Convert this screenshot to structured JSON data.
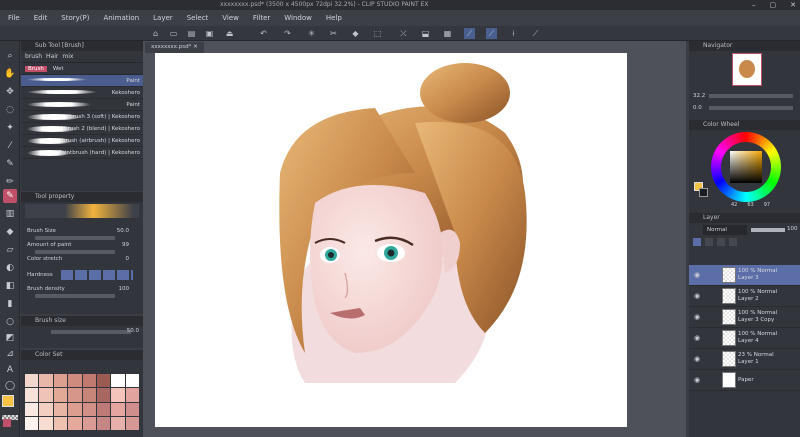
{
  "window": {
    "title": "xxxxxxxx.psd* (3500 x 4500px 72dpi 32.2%) - CLIP STUDIO PAINT EX",
    "doc_tab": "xxxxxxxx.psd*",
    "controls": [
      "–",
      "▢",
      "✕"
    ]
  },
  "menu": [
    "File",
    "Edit",
    "Story(P)",
    "Animation",
    "Layer",
    "Select",
    "View",
    "Filter",
    "Window",
    "Help"
  ],
  "subtool": {
    "title": "Sub Tool [Brush]",
    "tabs": [
      "brush",
      "Hair",
      "mix"
    ],
    "groups": [
      "Brush",
      "Wet"
    ],
    "brushes": [
      "Paint",
      "Paintbrush (soft)",
      "Paintbrush (blend)",
      "Paintbrush (airbrush)",
      "Paintbrush (hard)",
      "Kekoshero",
      "Kekoshero"
    ],
    "labels": [
      "Paint",
      "Paintbrush 3 (soft) | Kekoshero",
      "Paintbrush 2 (blend) | Kekoshero",
      "Paintbrush (airbrush) | Kekoshero",
      "Paintbrush (hard) | Kekoshero"
    ]
  },
  "toolprop": {
    "title": "Tool property",
    "brush_size_label": "Brush Size",
    "brush_size_value": "50.0",
    "amount_label": "Amount of paint",
    "amount_value": "99",
    "stretch_label": "Color stretch",
    "stretch_value": "0",
    "hardness_label": "Hardness",
    "density_label": "Brush density",
    "density_value": "100"
  },
  "brushsize": {
    "title": "Brush size",
    "value": "50.0"
  },
  "colorset": {
    "title": "Color Set"
  },
  "navigator": {
    "title": "Navigator",
    "zoom": "32.2",
    "rotate": "0.0"
  },
  "colorwheel": {
    "title": "Color Wheel",
    "values": [
      "42",
      "63",
      "97"
    ]
  },
  "layer": {
    "title": "Layer",
    "blend": "Normal",
    "opacity": "100",
    "rows": [
      {
        "name": "100 % Normal\nLayer 3",
        "selected": true
      },
      {
        "name": "100 % Normal\nLayer 2",
        "selected": false
      },
      {
        "name": "100 % Normal\nLayer 3 Copy",
        "selected": false
      },
      {
        "name": "100 % Normal\nLayer 4",
        "selected": false
      },
      {
        "name": "23 % Normal\nLayer 1",
        "selected": false
      },
      {
        "name": "Paper",
        "selected": false
      }
    ]
  },
  "colors": {
    "accent": "#5b6ea8",
    "hair": "#c8894a",
    "main_color": "#f5c242",
    "panel": "#32353c"
  }
}
